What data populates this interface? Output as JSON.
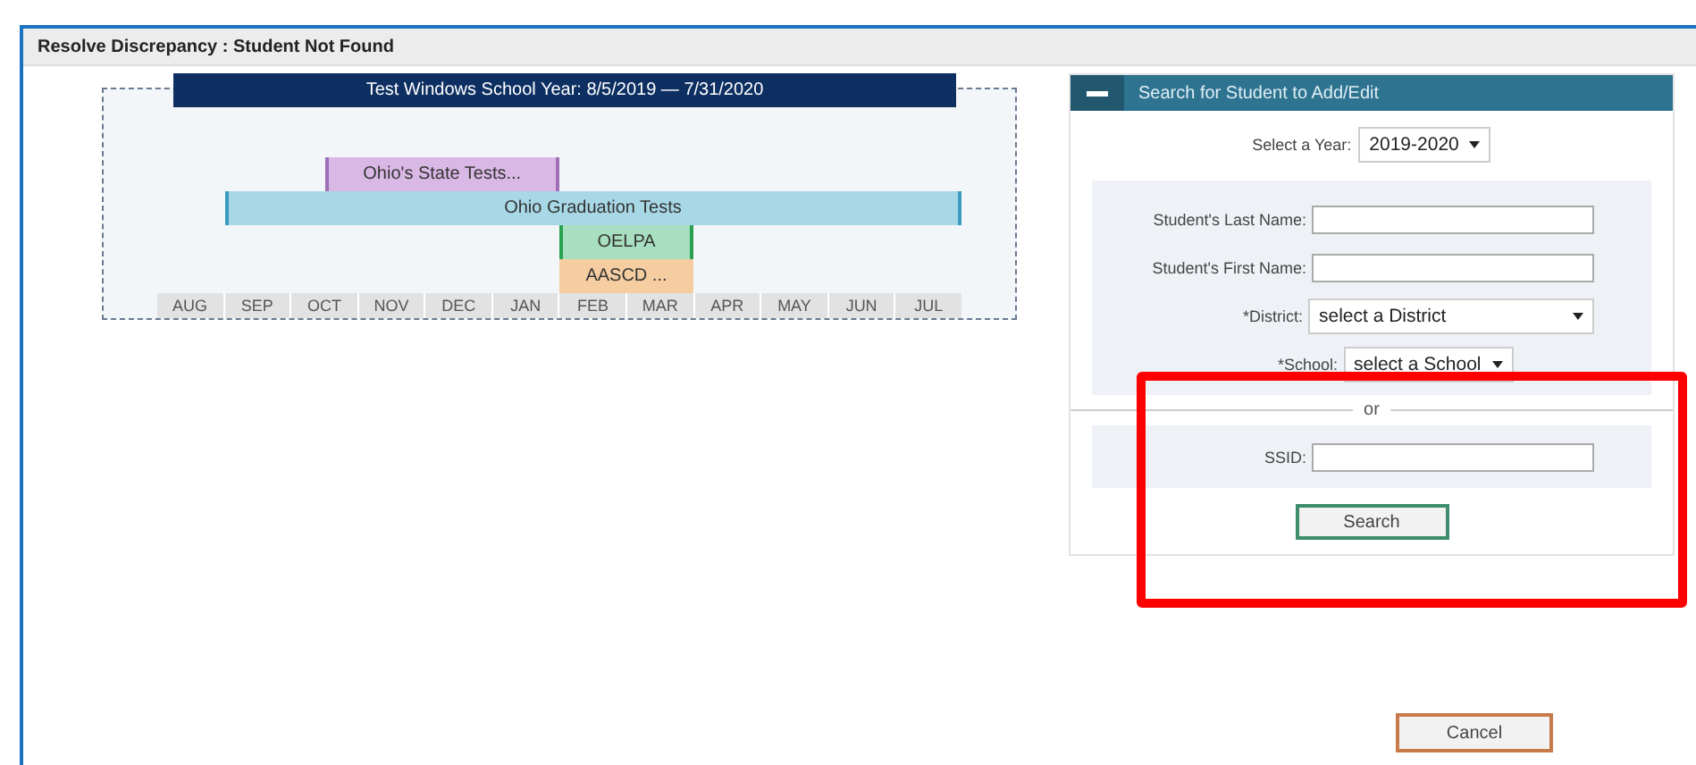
{
  "window": {
    "title": "Resolve Discrepancy : Student Not Found"
  },
  "timeline": {
    "title": "Test Windows School Year: 8/5/2019 — 7/31/2020",
    "bars": [
      {
        "label": "Ohio's State Tests...",
        "color": "#d9b8e6"
      },
      {
        "label": "Ohio Graduation Tests",
        "color": "#a8d8e6"
      },
      {
        "label": "OELPA",
        "color": "#a8dfc0"
      },
      {
        "label": "AASCD ...",
        "color": "#f5cda0"
      }
    ],
    "months": [
      "AUG",
      "SEP",
      "OCT",
      "NOV",
      "DEC",
      "JAN",
      "FEB",
      "MAR",
      "APR",
      "MAY",
      "JUN",
      "JUL"
    ]
  },
  "search_panel": {
    "title": "Search for Student to Add/Edit",
    "expanded": true,
    "year": {
      "label": "Select a Year:",
      "value": "2019-2020"
    },
    "fields": [
      {
        "kind": "text",
        "label": "Student's Last Name:"
      },
      {
        "kind": "text",
        "label": "Student's First Name:"
      },
      {
        "kind": "select",
        "label": "*District:",
        "value": "select a District"
      },
      {
        "kind": "select",
        "label": "*School:",
        "value": "select a School"
      }
    ],
    "separator": "or",
    "ssid": {
      "label": "SSID:"
    },
    "search_button": "Search"
  },
  "cancel_button": "Cancel"
}
